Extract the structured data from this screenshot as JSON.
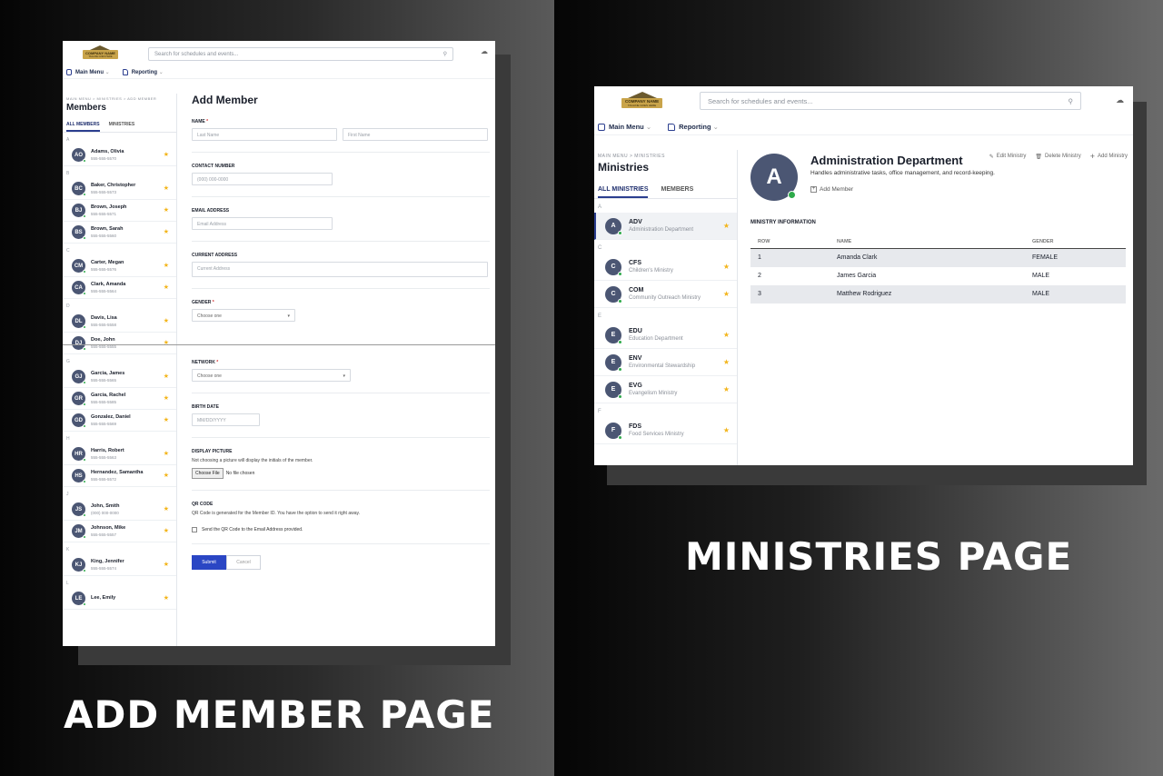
{
  "captions": {
    "left": "ADD MEMBER PAGE",
    "right": "MINISTRIES PAGE"
  },
  "colors": {
    "primary": "#2b3e8f",
    "avatar": "#4b5673",
    "online": "#2eaa4a",
    "star": "#f3b51b",
    "required": "#d32f2f"
  },
  "app": {
    "logo_text": "COMPANY NAME",
    "logo_subtext": "TAGLINE GOES HERE",
    "search_placeholder": "Search for schedules and events...",
    "nav": [
      {
        "label": "Main Menu",
        "icon": "calendar-icon"
      },
      {
        "label": "Reporting",
        "icon": "folder-icon"
      }
    ]
  },
  "add_member": {
    "breadcrumb": "MAIN MENU  >  MINISTRIES  >  ADD MEMBER",
    "sidebar_title": "Members",
    "tabs": [
      "ALL MEMBERS",
      "MINISTRIES"
    ],
    "groups": [
      {
        "letter": "A",
        "members": [
          {
            "initials": "AO",
            "name": "Adams, Olivia",
            "phone": "555-555-5570"
          }
        ]
      },
      {
        "letter": "B",
        "members": [
          {
            "initials": "BC",
            "name": "Baker, Christopher",
            "phone": "555-555-5573"
          },
          {
            "initials": "BJ",
            "name": "Brown, Joseph",
            "phone": "555-555-5571"
          },
          {
            "initials": "BS",
            "name": "Brown, Sarah",
            "phone": "555-555-5560"
          }
        ]
      },
      {
        "letter": "C",
        "members": [
          {
            "initials": "CM",
            "name": "Carter, Megan",
            "phone": "555-555-5576"
          },
          {
            "initials": "CA",
            "name": "Clark, Amanda",
            "phone": "555-555-5564"
          }
        ]
      },
      {
        "letter": "D",
        "members": [
          {
            "initials": "DL",
            "name": "Davis, Lisa",
            "phone": "555-555-5558"
          },
          {
            "initials": "DJ",
            "name": "Doe, John",
            "phone": "555-555-5555"
          }
        ]
      },
      {
        "letter": "G",
        "members": [
          {
            "initials": "GJ",
            "name": "Garcia, James",
            "phone": "555-555-5565"
          },
          {
            "initials": "GR",
            "name": "Garcia, Rachel",
            "phone": "555-555-5585"
          },
          {
            "initials": "GD",
            "name": "Gonzalez, Daniel",
            "phone": "555-555-5569"
          }
        ]
      },
      {
        "letter": "H",
        "members": [
          {
            "initials": "HR",
            "name": "Harris, Robert",
            "phone": "555-555-5563"
          },
          {
            "initials": "HS",
            "name": "Hernandez, Samantha",
            "phone": "555-555-5572"
          }
        ]
      },
      {
        "letter": "J",
        "members": [
          {
            "initials": "JS",
            "name": "John, Smith",
            "phone": "(000) 000-0000"
          },
          {
            "initials": "JM",
            "name": "Johnson, Mike",
            "phone": "555-555-5557"
          }
        ]
      },
      {
        "letter": "K",
        "members": [
          {
            "initials": "KJ",
            "name": "King, Jennifer",
            "phone": "555-555-5574"
          }
        ]
      },
      {
        "letter": "L",
        "members": [
          {
            "initials": "LE",
            "name": "Lee, Emily",
            "phone": ""
          }
        ]
      }
    ],
    "form": {
      "title": "Add Member",
      "name_label": "NAME",
      "last_name_placeholder": "Last Name",
      "first_name_placeholder": "First Name",
      "contact_label": "CONTACT NUMBER",
      "contact_placeholder": "(000) 000-0000",
      "email_label": "EMAIL ADDRESS",
      "email_placeholder": "Email Address",
      "address_label": "CURRENT ADDRESS",
      "address_placeholder": "Current Address",
      "gender_label": "GENDER",
      "gender_value": "Choose one",
      "network_label": "NETWORK",
      "network_value": "Choose one",
      "birth_label": "BIRTH DATE",
      "birth_placeholder": "MM/DD/YYYY",
      "picture_label": "DISPLAY PICTURE",
      "picture_help": "Not choosing a picture will display the initials of the member.",
      "choose_file": "Choose File",
      "no_file": "No file chosen",
      "qr_label": "QR CODE",
      "qr_help": "QR Code is generated for the Member ID. You have the option to send it right away.",
      "qr_checkbox": "Send the QR Code to the Email Address provided.",
      "submit": "Submit",
      "cancel": "Cancel"
    }
  },
  "ministries": {
    "breadcrumb": "MAIN MENU  >  MINISTRIES",
    "sidebar_title": "Ministries",
    "tabs": [
      "ALL MINISTRIES",
      "MEMBERS"
    ],
    "groups": [
      {
        "letter": "A",
        "items": [
          {
            "initial": "A",
            "code": "ADV",
            "name": "Administration Department",
            "selected": true
          }
        ]
      },
      {
        "letter": "C",
        "items": [
          {
            "initial": "C",
            "code": "CFS",
            "name": "Children's Ministry"
          },
          {
            "initial": "C",
            "code": "COM",
            "name": "Community Outreach Ministry"
          }
        ]
      },
      {
        "letter": "E",
        "items": [
          {
            "initial": "E",
            "code": "EDU",
            "name": "Education Department"
          },
          {
            "initial": "E",
            "code": "ENV",
            "name": "Environmental Stewardship"
          },
          {
            "initial": "E",
            "code": "EVG",
            "name": "Evangelism Ministry"
          }
        ]
      },
      {
        "letter": "F",
        "items": [
          {
            "initial": "F",
            "code": "FDS",
            "name": "Food Services Ministry"
          }
        ]
      }
    ],
    "detail": {
      "initial": "A",
      "title": "Administration Department",
      "description": "Handles administrative tasks, office management, and record-keeping.",
      "add_member": "Add Member",
      "actions": [
        "Edit Ministry",
        "Delete Ministry",
        "Add Ministry"
      ],
      "info_label": "MINISTRY INFORMATION",
      "columns": [
        "ROW",
        "NAME",
        "GENDER"
      ],
      "rows": [
        [
          "1",
          "Amanda Clark",
          "FEMALE"
        ],
        [
          "2",
          "James Garcia",
          "MALE"
        ],
        [
          "3",
          "Matthew Rodriguez",
          "MALE"
        ]
      ]
    }
  }
}
